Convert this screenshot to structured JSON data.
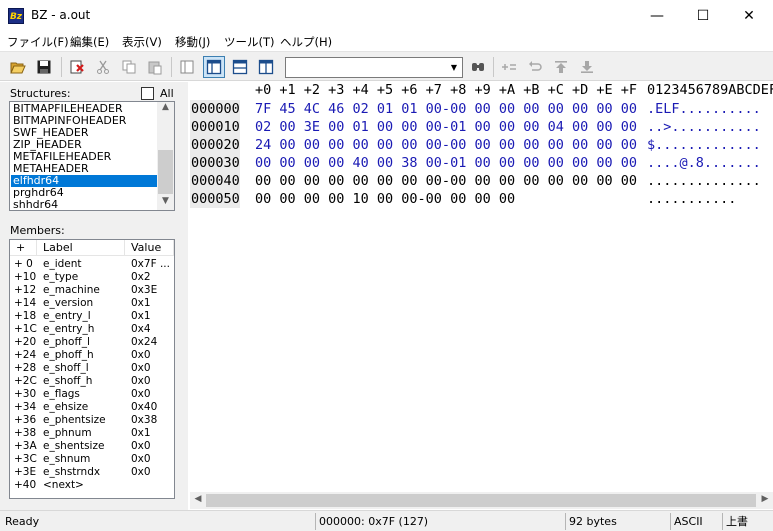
{
  "window": {
    "title": "BZ - a.out",
    "app_icon_text": "Bz",
    "minimize": "—",
    "maximize": "☐",
    "close": "✕"
  },
  "menu": [
    "ファイル(F)",
    "編集(E)",
    "表示(V)",
    "移動(J)",
    "ツール(T)",
    "ヘルプ(H)"
  ],
  "toolbar": {
    "buttons": [
      "open-icon",
      "save-icon",
      "clear-icon",
      "cut-icon",
      "copy-icon",
      "paste-icon",
      "single-view-icon",
      "split-vertical-icon",
      "split-horizontal-icon",
      "split-window-icon",
      "find-icon",
      "compare-icon",
      "undo-jump-icon",
      "jump-top-icon",
      "jump-bottom-icon"
    ],
    "search_value": ""
  },
  "structures": {
    "label": "Structures:",
    "all_label": "All",
    "all_checked": false,
    "items": [
      "BITMAPFILEHEADER",
      "BITMAPINFOHEADER",
      "SWF_HEADER",
      "ZIP_HEADER",
      "METAFILEHEADER",
      "METAHEADER",
      "elfhdr64",
      "prghdr64",
      "shhdr64"
    ],
    "selected": "elfhdr64"
  },
  "members": {
    "label": "Members:",
    "columns": [
      "+",
      "Label",
      "Value"
    ],
    "rows": [
      {
        "offset": "+ 0",
        "label": "e_ident",
        "value": "0x7F ..."
      },
      {
        "offset": "+10",
        "label": "e_type",
        "value": "0x2"
      },
      {
        "offset": "+12",
        "label": "e_machine",
        "value": "0x3E"
      },
      {
        "offset": "+14",
        "label": "e_version",
        "value": "0x1"
      },
      {
        "offset": "+18",
        "label": "e_entry_l",
        "value": "0x1"
      },
      {
        "offset": "+1C",
        "label": "e_entry_h",
        "value": "0x4"
      },
      {
        "offset": "+20",
        "label": "e_phoff_l",
        "value": "0x24"
      },
      {
        "offset": "+24",
        "label": "e_phoff_h",
        "value": "0x0"
      },
      {
        "offset": "+28",
        "label": "e_shoff_l",
        "value": "0x0"
      },
      {
        "offset": "+2C",
        "label": "e_shoff_h",
        "value": "0x0"
      },
      {
        "offset": "+30",
        "label": "e_flags",
        "value": "0x0"
      },
      {
        "offset": "+34",
        "label": "e_ehsize",
        "value": "0x40"
      },
      {
        "offset": "+36",
        "label": "e_phentsize",
        "value": "0x38"
      },
      {
        "offset": "+38",
        "label": "e_phnum",
        "value": "0x1"
      },
      {
        "offset": "+3A",
        "label": "e_shentsize",
        "value": "0x0"
      },
      {
        "offset": "+3C",
        "label": "e_shnum",
        "value": "0x0"
      },
      {
        "offset": "+3E",
        "label": "e_shstrndx",
        "value": "0x0"
      },
      {
        "offset": "+40",
        "label": "<next>",
        "value": ""
      }
    ]
  },
  "hex": {
    "header": "+0 +1 +2 +3 +4 +5 +6 +7 +8 +9 +A +B +C +D +E +F",
    "ascii_header": "0123456789ABCDEF",
    "rows": [
      {
        "addr": "000000",
        "bytes": "7F 45 4C 46 02 01 01 00-00 00 00 00 00 00 00 00",
        "ascii": ".ELF..........",
        "highlight": true
      },
      {
        "addr": "000010",
        "bytes": "02 00 3E 00 01 00 00 00-01 00 00 00 04 00 00 00",
        "ascii": "..>...........",
        "highlight": true
      },
      {
        "addr": "000020",
        "bytes": "24 00 00 00 00 00 00 00-00 00 00 00 00 00 00 00",
        "ascii": "$.............",
        "highlight": true
      },
      {
        "addr": "000030",
        "bytes": "00 00 00 00 40 00 38 00-01 00 00 00 00 00 00 00",
        "ascii": "....@.8.......",
        "highlight": true
      },
      {
        "addr": "000040",
        "bytes": "00 00 00 00 00 00 00 00-00 00 00 00 00 00 00 00",
        "ascii": "..............",
        "highlight": false
      },
      {
        "addr": "000050",
        "bytes": "00 00 00 00 10 00 00-00 00 00 00",
        "ascii": "...........",
        "highlight": false
      }
    ]
  },
  "status": {
    "ready": "Ready",
    "offset": "000000: 0x7F (127)",
    "size": "92 bytes",
    "encoding": "ASCII",
    "mode": "上書"
  },
  "colors": {
    "selection": "#0078d7",
    "hex_text": "#1a1ab4",
    "address_bg": "#ebebeb"
  }
}
